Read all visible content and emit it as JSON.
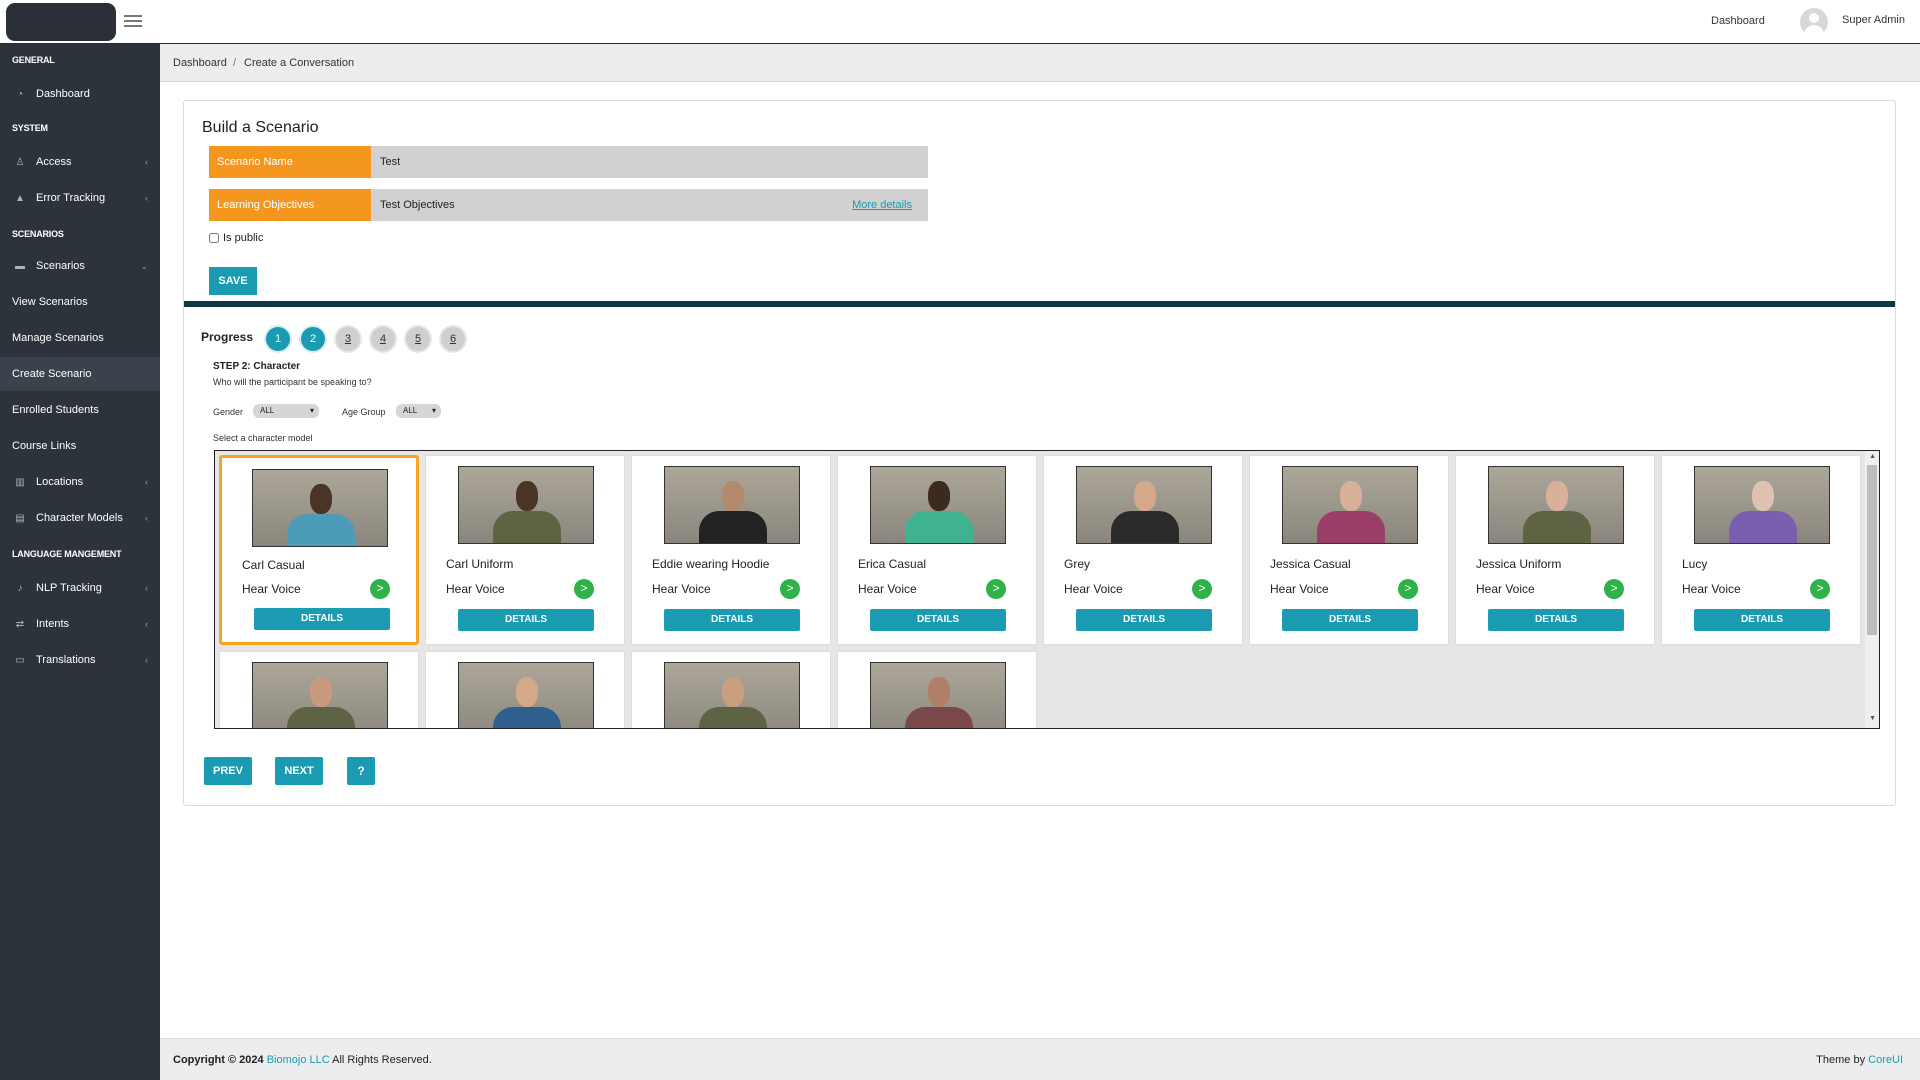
{
  "header": {
    "dashboard_link": "Dashboard",
    "user_name": "Super Admin"
  },
  "sidebar": {
    "sections": [
      "GENERAL",
      "SYSTEM",
      "SCENARIOS",
      "LANGUAGE MANGEMENT"
    ],
    "items": [
      {
        "label": "Dashboard",
        "icon": "dashboard-icon"
      },
      {
        "label": "Access",
        "icon": "user-icon"
      },
      {
        "label": "Error Tracking",
        "icon": "warning-icon"
      },
      {
        "label": "Scenarios",
        "icon": "folder-icon"
      },
      {
        "label": "View Scenarios"
      },
      {
        "label": "Manage Scenarios"
      },
      {
        "label": "Create Scenario"
      },
      {
        "label": "Enrolled Students"
      },
      {
        "label": "Course Links"
      },
      {
        "label": "Locations",
        "icon": "building-icon"
      },
      {
        "label": "Character Models",
        "icon": "document-icon"
      },
      {
        "label": "NLP Tracking",
        "icon": "microphone-icon"
      },
      {
        "label": "Intents",
        "icon": "arrows-icon"
      },
      {
        "label": "Translations",
        "icon": "keyboard-icon"
      }
    ],
    "active": "Create Scenario"
  },
  "breadcrumb": [
    "Dashboard",
    "/",
    "Create a Conversation"
  ],
  "builder": {
    "title": "Build a Scenario",
    "scenario_name_label": "Scenario Name",
    "scenario_name_value": "Test",
    "objectives_label": "Learning Objectives",
    "objectives_value": "Test Objectives",
    "more_details": "More details",
    "is_public_label": "Is public",
    "is_public": false,
    "save_label": "SAVE"
  },
  "progress": {
    "label": "Progress",
    "steps": [
      "1",
      "2",
      "3",
      "4",
      "5",
      "6"
    ],
    "completed": 2,
    "step_title": "STEP 2: Character",
    "step_subtitle": "Who will the participant be speaking to?",
    "gender_label": "Gender",
    "gender_value": "ALL",
    "age_label": "Age Group",
    "age_value": "ALL",
    "select_label": "Select a character model"
  },
  "characters": [
    {
      "name": "Carl Casual",
      "voice": "Hear Voice",
      "details": "DETAILS",
      "selected": true,
      "skin": "#4a3426",
      "shirt": "#4c9bb8"
    },
    {
      "name": "Carl Uniform",
      "voice": "Hear Voice",
      "details": "DETAILS",
      "skin": "#4a3426",
      "shirt": "#5e6443"
    },
    {
      "name": "Eddie wearing Hoodie",
      "voice": "Hear Voice",
      "details": "DETAILS",
      "skin": "#b58a6c",
      "shirt": "#222222"
    },
    {
      "name": "Erica Casual",
      "voice": "Hear Voice",
      "details": "DETAILS",
      "skin": "#3d2a1f",
      "shirt": "#3fb391"
    },
    {
      "name": "Grey",
      "voice": "Hear Voice",
      "details": "DETAILS",
      "skin": "#d4a98a",
      "shirt": "#2b2b2b"
    },
    {
      "name": "Jessica Casual",
      "voice": "Hear Voice",
      "details": "DETAILS",
      "skin": "#d9b09a",
      "shirt": "#9b3f68"
    },
    {
      "name": "Jessica Uniform",
      "voice": "Hear Voice",
      "details": "DETAILS",
      "skin": "#d9b09a",
      "shirt": "#5e6443"
    },
    {
      "name": "Lucy",
      "voice": "Hear Voice",
      "details": "DETAILS",
      "skin": "#e0c2b0",
      "shirt": "#7a5fb0"
    },
    {
      "skin": "#c99a80",
      "shirt": "#5e6443"
    },
    {
      "skin": "#d4a98a",
      "shirt": "#2f5f8f"
    },
    {
      "skin": "#c9a07e",
      "shirt": "#5e6443"
    },
    {
      "skin": "#b07f68",
      "shirt": "#7a4848"
    }
  ],
  "nav": {
    "prev": "PREV",
    "next": "NEXT",
    "help": "?"
  },
  "footer": {
    "copyright": "Copyright © 2024",
    "company": "Biomojo LLC",
    "rights": "All Rights Reserved.",
    "theme_by": "Theme by",
    "theme_name": "CoreUI"
  },
  "colors": {
    "accent": "#1a9bb2",
    "orange": "#f5961f",
    "sidebar": "#2d333b",
    "play": "#2fb24a"
  }
}
